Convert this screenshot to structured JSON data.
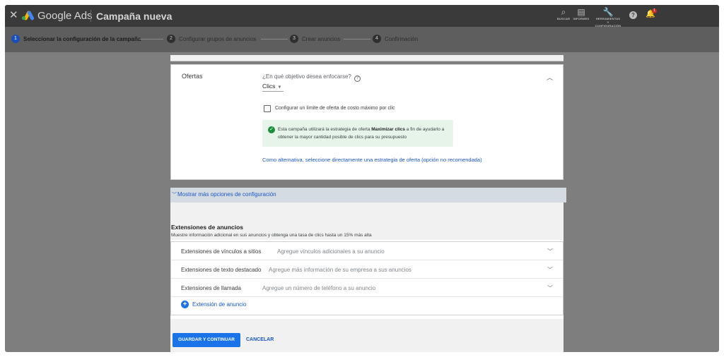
{
  "topbar": {
    "close_glyph": "✕",
    "brand": "Google Ads",
    "campaign_title": "Campaña nueva",
    "tools": [
      {
        "label": "BUSCAR",
        "icon": "search-icon",
        "glyph": "⌕"
      },
      {
        "label": "INFORMES",
        "icon": "reports-icon",
        "glyph": "▤"
      },
      {
        "label": "HERRAMIENTAS Y CONFIGURACIÓN",
        "icon": "wrench-icon",
        "glyph": "🔧"
      }
    ],
    "help_glyph": "?",
    "bell_glyph": "🔔",
    "notification_count": "1"
  },
  "stepper": {
    "steps": [
      {
        "num": "1",
        "label": "Seleccionar la configuración de la campaña"
      },
      {
        "num": "2",
        "label": "Configurar grupos de anuncios"
      },
      {
        "num": "3",
        "label": "Crear anuncios"
      },
      {
        "num": "4",
        "label": "Confirmación"
      }
    ]
  },
  "bids": {
    "title": "Ofertas",
    "question": "¿En qué objetivo desea enfocarse?",
    "help_glyph": "?",
    "selected_option": "Clics",
    "checkbox_label": "Configurar un límite de oferta de costo máximo por clic",
    "info_prefix": "Esta campaña utilizará la estrategia de oferta ",
    "info_strong": "Maximizar clics",
    "info_suffix": " a fin de ayudarlo a obtener la mayor cantidad posible de clics para su presupuesto",
    "alt_link": "Como alternativa, seleccione directamente una estrategia de oferta (opción no recomendada)"
  },
  "more_options": {
    "label": "Mostrar más opciones de configuración"
  },
  "extensions": {
    "title": "Extensiones de anuncios",
    "subtitle": "Muestre información adicional en sus anuncios y obtenga una tasa de clics hasta un 15% más alta",
    "rows": [
      {
        "name": "Extensiones de vínculos a sitios",
        "hint": "Agregue vínculos adicionales a su anuncio"
      },
      {
        "name": "Extensiones de texto destacado",
        "hint": "Agregue más información de su empresa a sus anuncios"
      },
      {
        "name": "Extensiones de llamada",
        "hint": "Agregue un número de teléfono a su anuncio"
      }
    ],
    "add_label": "Extensión de anuncio"
  },
  "footer": {
    "save_label": "GUARDAR Y CONTINUAR",
    "cancel_label": "CANCELAR"
  }
}
